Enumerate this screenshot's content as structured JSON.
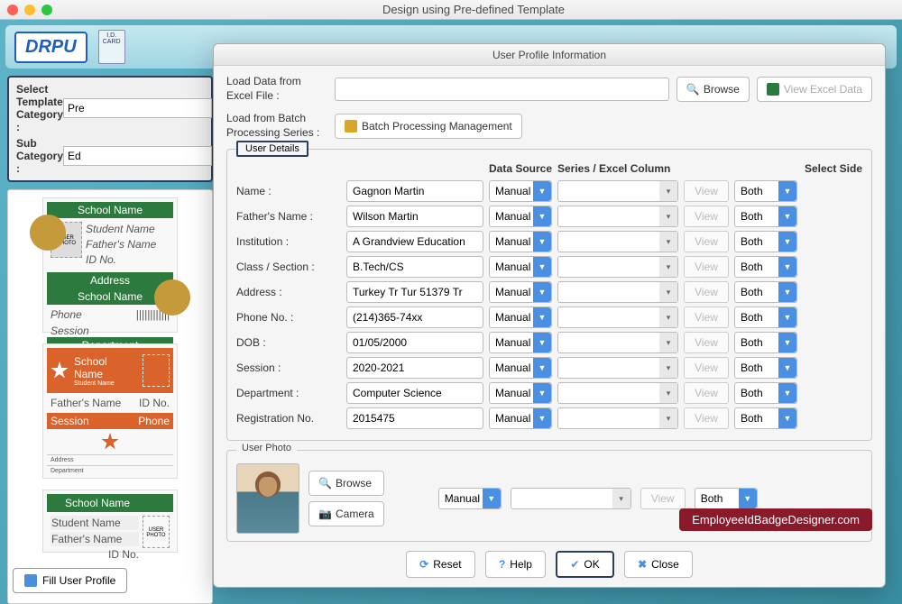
{
  "window": {
    "title": "Design using Pre-defined Template"
  },
  "brand": {
    "logo": "DRPU",
    "idcard_label": "I.D. CARD"
  },
  "leftpanel": {
    "cat_label": "Select Template Category :",
    "cat_value": "Pre",
    "sub_label": "Sub Category :",
    "sub_value": "Ed",
    "templates": {
      "t1": {
        "school": "School Name",
        "student": "Student Name",
        "father": "Father's Name",
        "id": "ID No.",
        "address": "Address",
        "phone": "Phone",
        "session": "Session",
        "dept": "Department",
        "photo": "USER PHOTO"
      },
      "t2": {
        "school": "School Name",
        "student": "Student Name",
        "father": "Father's Name",
        "id": "ID No.",
        "session": "Session",
        "phone": "Phone",
        "address": "Address",
        "dept": "Department"
      },
      "t3": {
        "school": "School Name",
        "student": "Student Name",
        "father": "Father's Name",
        "id": "ID No.",
        "photo": "USER PHOTO"
      }
    },
    "fill_btn": "Fill User Profile"
  },
  "dialog": {
    "title": "User Profile Information",
    "load_excel_label": "Load Data from Excel File :",
    "browse_btn": "Browse",
    "view_excel_btn": "View Excel Data",
    "load_batch_label": "Load from Batch Processing Series :",
    "batch_btn": "Batch Processing Management",
    "details_legend": "User Details",
    "headers": {
      "ds": "Data Source",
      "series": "Series / Excel Column",
      "side": "Select Side"
    },
    "fields": [
      {
        "label": "Name :",
        "value": "Gagnon Martin",
        "ds": "Manual",
        "view": "View",
        "side": "Both"
      },
      {
        "label": "Father's Name :",
        "value": "Wilson Martin",
        "ds": "Manual",
        "view": "View",
        "side": "Both"
      },
      {
        "label": "Institution :",
        "value": "A Grandview Education",
        "ds": "Manual",
        "view": "View",
        "side": "Both"
      },
      {
        "label": "Class / Section :",
        "value": "B.Tech/CS",
        "ds": "Manual",
        "view": "View",
        "side": "Both"
      },
      {
        "label": "Address :",
        "value": "Turkey Tr Tur 51379 Tr",
        "ds": "Manual",
        "view": "View",
        "side": "Both"
      },
      {
        "label": "Phone No. :",
        "value": "(214)365-74xx",
        "ds": "Manual",
        "view": "View",
        "side": "Both"
      },
      {
        "label": "DOB :",
        "value": "01/05/2000",
        "ds": "Manual",
        "view": "View",
        "side": "Both"
      },
      {
        "label": "Session :",
        "value": "2020-2021",
        "ds": "Manual",
        "view": "View",
        "side": "Both"
      },
      {
        "label": "Department :",
        "value": "Computer Science",
        "ds": "Manual",
        "view": "View",
        "side": "Both"
      },
      {
        "label": "Registration No.",
        "value": "2015475",
        "ds": "Manual",
        "view": "View",
        "side": "Both"
      }
    ],
    "photo_legend": "User Photo",
    "photo_browse": "Browse",
    "photo_camera": "Camera",
    "photo_ds": "Manual",
    "photo_view": "View",
    "photo_side": "Both",
    "watermark": "EmployeeIdBadgeDesigner.com",
    "footer": {
      "reset": "Reset",
      "help": "Help",
      "ok": "OK",
      "close": "Close"
    }
  }
}
